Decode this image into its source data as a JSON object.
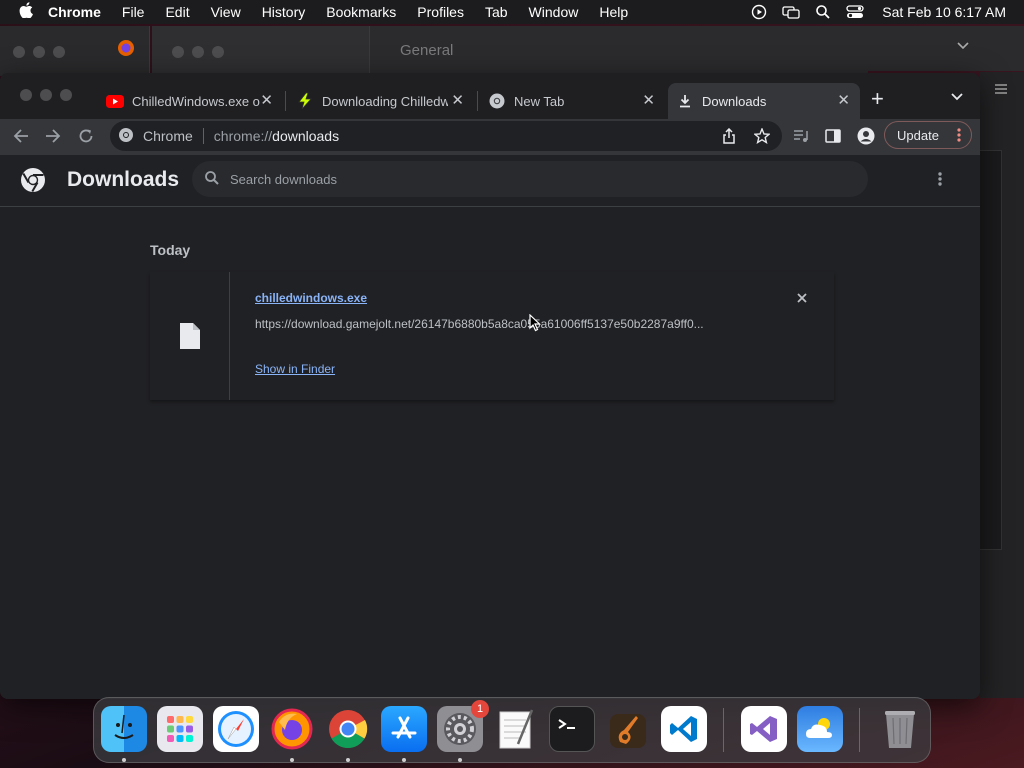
{
  "menubar": {
    "app": "Chrome",
    "items": [
      "File",
      "Edit",
      "View",
      "History",
      "Bookmarks",
      "Profiles",
      "Tab",
      "Window",
      "Help"
    ],
    "clock": "Sat Feb 10  6:17 AM"
  },
  "background_window": {
    "title": "General"
  },
  "tabs": [
    {
      "title": "ChilledWindows.exe o",
      "favicon": "youtube-icon",
      "active": false
    },
    {
      "title": "Downloading Chilledw",
      "favicon": "gamejolt-icon",
      "active": false
    },
    {
      "title": "New Tab",
      "favicon": "chrome-icon",
      "active": false
    },
    {
      "title": "Downloads",
      "favicon": "download-icon",
      "active": true
    }
  ],
  "omnibox": {
    "site_label": "Chrome",
    "url_scheme": "chrome://",
    "url_host": "downloads"
  },
  "toolbar": {
    "update_label": "Update"
  },
  "downloads_page": {
    "title": "Downloads",
    "search_placeholder": "Search downloads",
    "section_label": "Today",
    "items": [
      {
        "filename": "chilledwindows.exe",
        "url": "https://download.gamejolt.net/26147b6880b5a8ca055a61006ff5137e50b2287a9ff0...",
        "action": "Show in Finder"
      }
    ]
  },
  "dock": {
    "apps": [
      "Finder",
      "Launchpad",
      "Safari",
      "Firefox",
      "Chrome",
      "App Store",
      "System Settings",
      "TextEdit",
      "Terminal",
      "GarageBand",
      "Visual Studio Code",
      "Visual Studio",
      "Weather",
      "Trash"
    ],
    "system_settings_badge": "1"
  },
  "colors": {
    "accent_link": "#8ab4f8",
    "page_bg": "#202124",
    "toolbar_bg": "#35363a"
  }
}
